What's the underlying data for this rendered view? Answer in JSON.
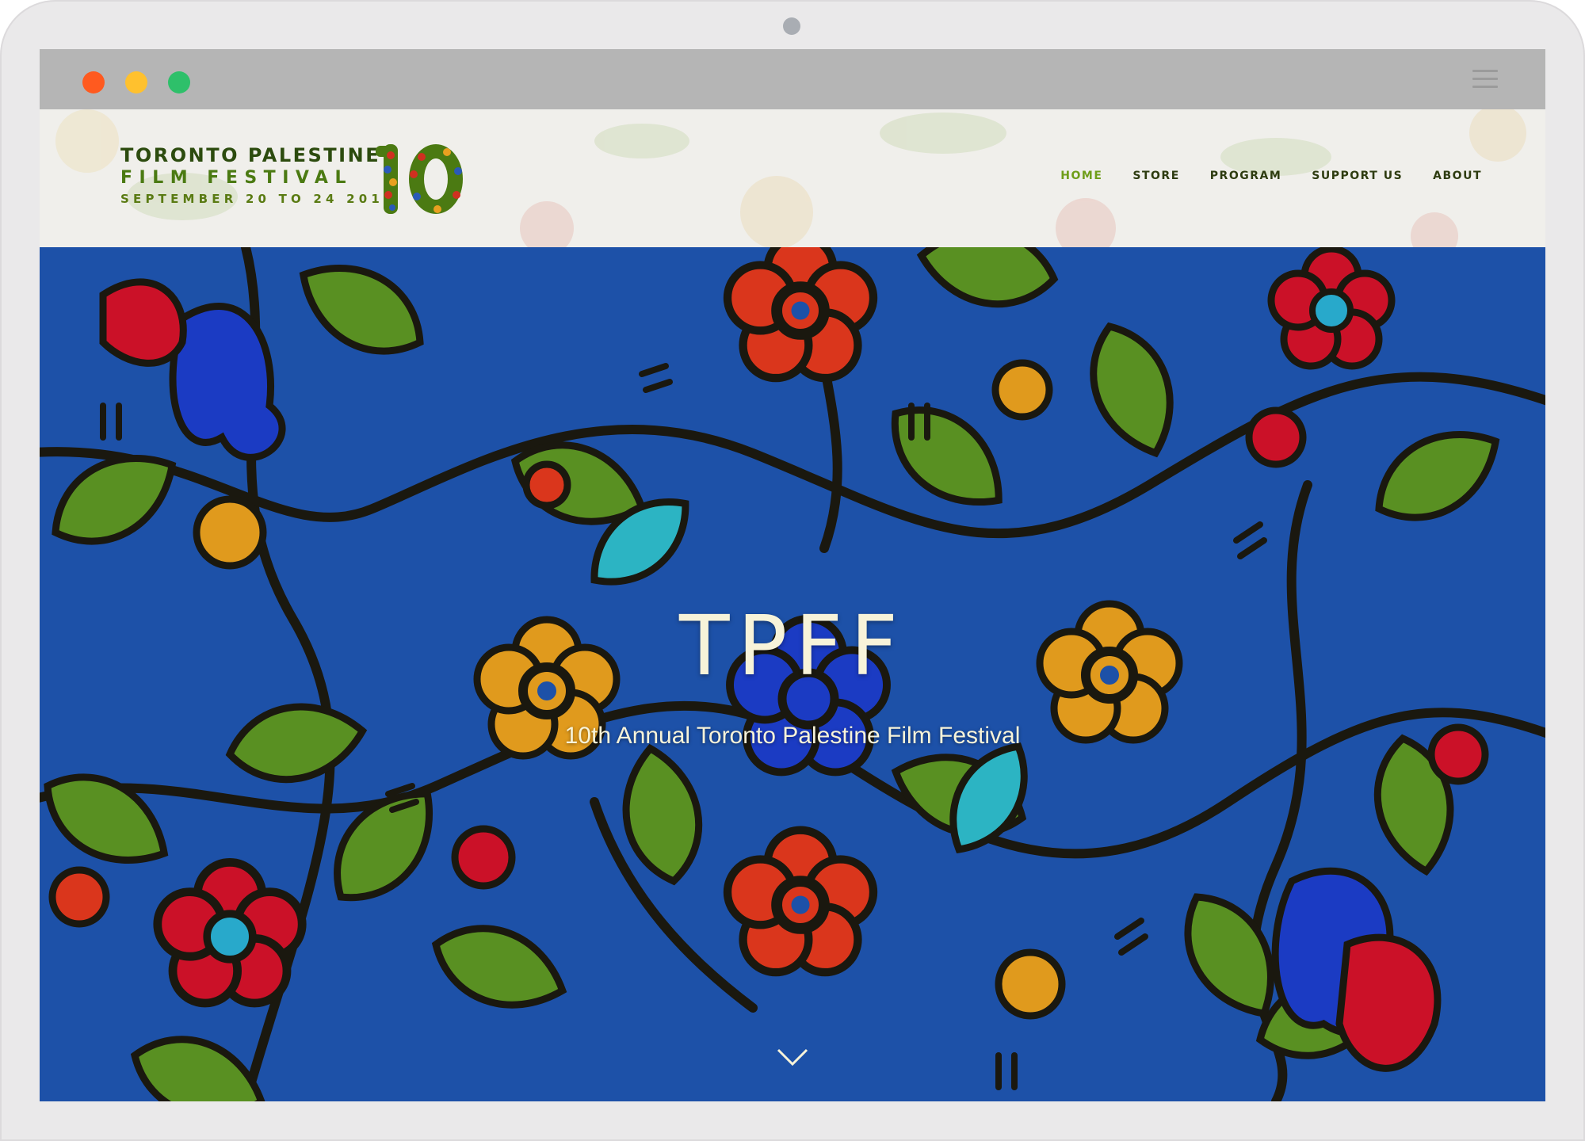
{
  "window": {
    "controls": [
      "close",
      "minimize",
      "maximize"
    ],
    "menu_icon": "hamburger-menu-icon"
  },
  "site": {
    "logo": {
      "line1": "TORONTO PALESTINE",
      "line2": "FILM FESTIVAL",
      "line3": "SEPTEMBER 20 TO 24 2017",
      "emblem_text": "10"
    },
    "nav": {
      "items": [
        {
          "label": "HOME",
          "active": true
        },
        {
          "label": "STORE",
          "active": false
        },
        {
          "label": "PROGRAM",
          "active": false
        },
        {
          "label": "SUPPORT US",
          "active": false
        },
        {
          "label": "ABOUT",
          "active": false
        }
      ]
    }
  },
  "hero": {
    "title": "TPFF",
    "subtitle": "10th Annual Toronto Palestine Film Festival",
    "scroll_icon": "chevron-down-icon"
  },
  "colors": {
    "accent": "#6f9e19",
    "nav_text": "#2e3c10",
    "hero_background": "#1f57b3",
    "header_background": "#f0efeb"
  }
}
